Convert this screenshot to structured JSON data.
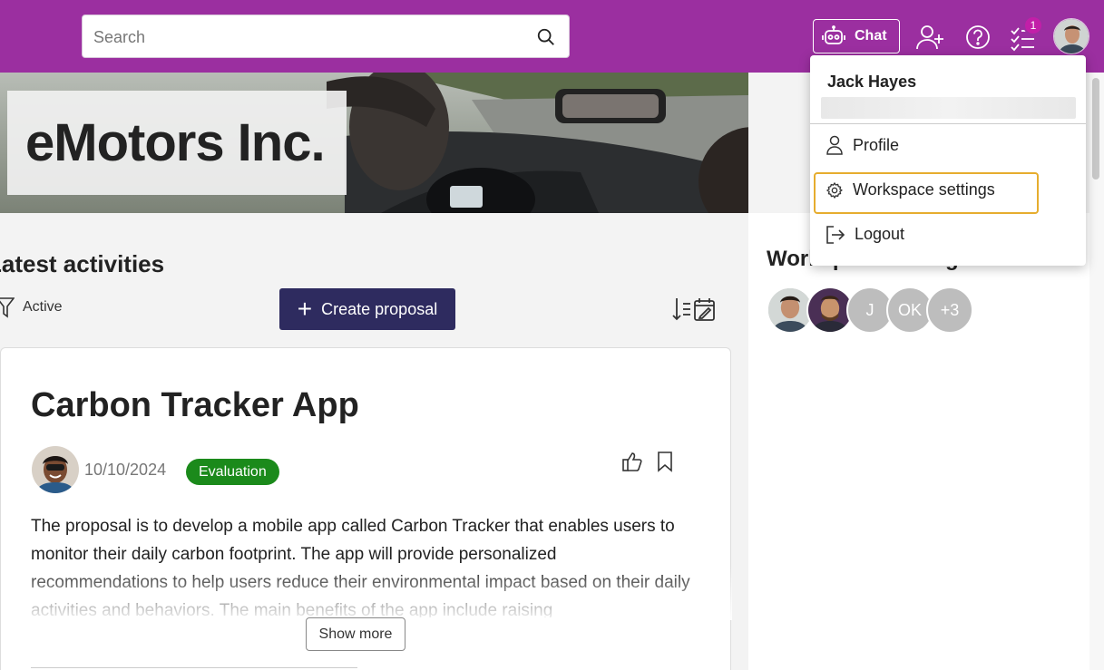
{
  "search": {
    "placeholder": "Search"
  },
  "header": {
    "chat_label": "Chat",
    "notification_count": "1"
  },
  "banner": {
    "org_name": "eMotors Inc."
  },
  "activities": {
    "title": "Latest activities",
    "filter_label": "Active",
    "create_label": "Create proposal"
  },
  "card": {
    "title": "Carbon Tracker App",
    "date": "10/10/2024",
    "status": "Evaluation",
    "description": "The proposal is to develop a mobile app called Carbon Tracker that enables users to monitor their daily carbon footprint. The app will provide personalized recommendations to help users reduce their environmental impact based on their daily activities and behaviors. The main benefits of the app include raising",
    "show_more": "Show more"
  },
  "right_panel": {
    "title": "Workspace managers",
    "avatars": [
      "",
      "",
      "J",
      "OK",
      "+3"
    ]
  },
  "user_menu": {
    "name": "Jack Hayes",
    "items": [
      "Profile",
      "Workspace settings",
      "Logout"
    ]
  },
  "colors": {
    "topbar": "#9b2fa0",
    "primary_button": "#2e2b5f",
    "status_green": "#1b8a1b",
    "highlight": "#e6ad2e",
    "badge": "#c21fa8"
  }
}
